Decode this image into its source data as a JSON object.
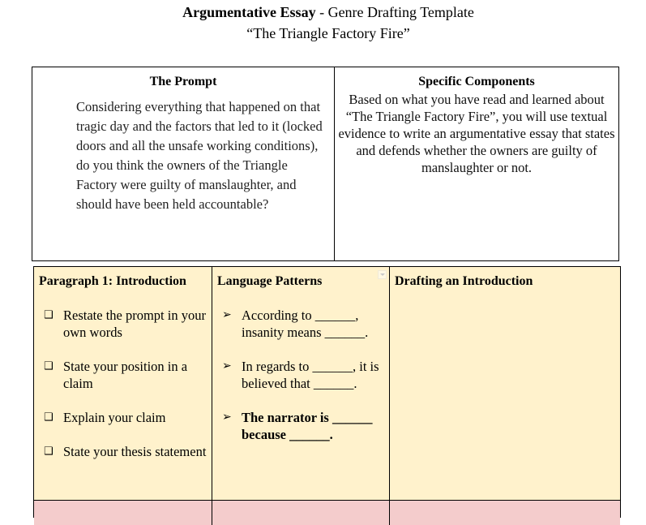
{
  "document": {
    "title_bold": "Argumentative Essay",
    "title_rest": " - Genre Drafting Template",
    "subtitle": "“The Triangle Factory Fire”"
  },
  "top_table": {
    "prompt": {
      "heading": "The Prompt",
      "body": "Considering everything that happened on that tragic day and the factors that led to it (locked doors and all the unsafe working conditions), do you think the owners of the Triangle Factory were guilty of manslaughter, and should have been held accountable?"
    },
    "components": {
      "heading": "Specific Components",
      "body": "Based on what you have read and learned about “The Triangle Factory Fire”, you will use textual evidence to write an argumentative essay that states and defends whether the owners are guilty of manslaughter or not."
    }
  },
  "lower_table": {
    "colors": {
      "row1_bg": "#fff2cc",
      "row2_bg": "#f4cccc"
    },
    "paragraph1": {
      "heading": "Paragraph 1: Introduction",
      "bullet_icon": "checkbox-icon",
      "bullet_glyph": "❑",
      "items": [
        "Restate the prompt in your own words",
        "State your position in a claim",
        "Explain your claim",
        "State your thesis statement"
      ]
    },
    "language_patterns": {
      "heading": "Language Patterns",
      "bullet_icon": "arrow-right-icon",
      "bullet_glyph": "➢",
      "items": [
        "According to ______, insanity means ______.",
        "In regards to ______, it is believed that ______.",
        "The narrator is ______ because ______."
      ]
    },
    "drafting": {
      "heading": "Drafting an Introduction",
      "content": ""
    }
  }
}
